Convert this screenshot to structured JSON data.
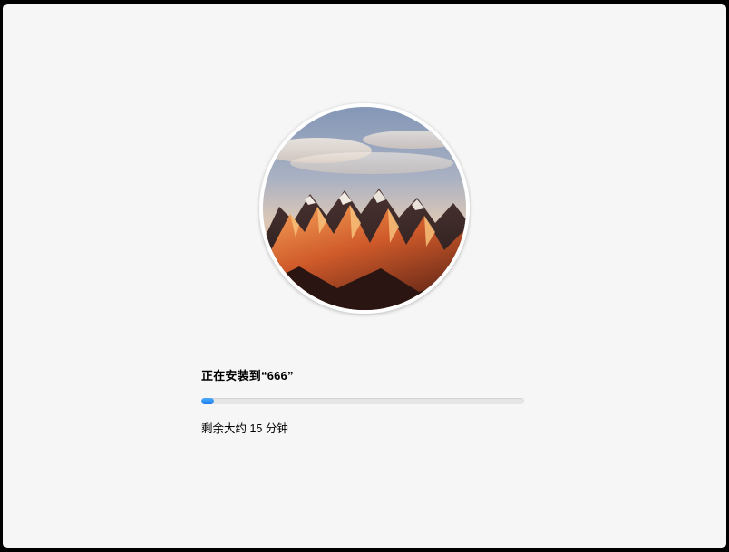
{
  "installer": {
    "status_text": "正在安装到“666”",
    "time_remaining_text": "剩余大约 15 分钟",
    "progress_percent": 4
  }
}
